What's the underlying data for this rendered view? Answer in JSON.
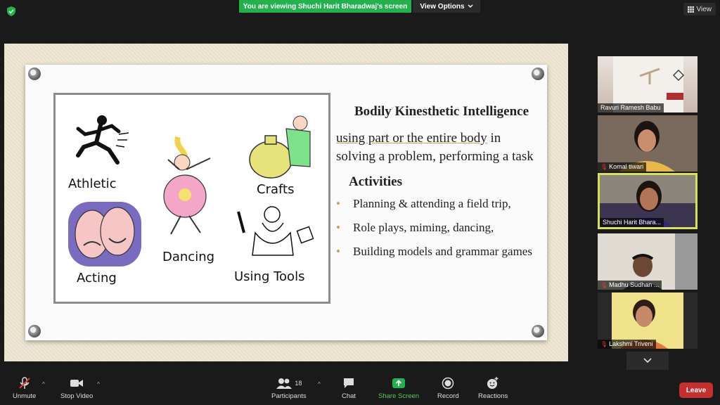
{
  "topbar": {
    "banner": "You are viewing Shuchi Harit Bharadwaj's screen",
    "view_options": "View Options",
    "view_button": "View"
  },
  "slide": {
    "clipart_labels": {
      "athletic": "Athletic",
      "dancing": "Dancing",
      "crafts": "Crafts",
      "acting": "Acting",
      "using_tools": "Using Tools"
    },
    "title": "Bodily Kinesthetic Intelligence",
    "description_part1": "using part or the entire body",
    "description_part2": " in solving a  problem, performing a task",
    "activities_title": "Activities",
    "activities": [
      "Planning & attending a field trip,",
      "Role plays, miming, dancing,",
      "Building models and grammar games"
    ]
  },
  "participants": [
    {
      "name": "Ravuri Ramesh Babu",
      "muted": false
    },
    {
      "name": "Komal tiwari",
      "muted": true
    },
    {
      "name": "Shuchi Harit Bhara...",
      "muted": false
    },
    {
      "name": "Madhu Sudhan ...",
      "muted": true
    },
    {
      "name": "Lakshmi Triveni",
      "muted": true
    }
  ],
  "toolbar": {
    "unmute": "Unmute",
    "stop_video": "Stop Video",
    "participants": "Participants",
    "participants_count": "18",
    "chat": "Chat",
    "share_screen": "Share Screen",
    "record": "Record",
    "reactions": "Reactions",
    "leave": "Leave"
  },
  "colors": {
    "banner": "#23b14d",
    "leave": "#c5302e",
    "active_speaker": "#d6e15a",
    "share_screen": "#4ccd62"
  },
  "icons": [
    "shield-icon",
    "chevron-down-icon",
    "grid-icon",
    "microphone-muted-icon",
    "video-camera-icon",
    "participants-icon",
    "chat-icon",
    "share-screen-icon",
    "record-icon",
    "reactions-icon"
  ]
}
